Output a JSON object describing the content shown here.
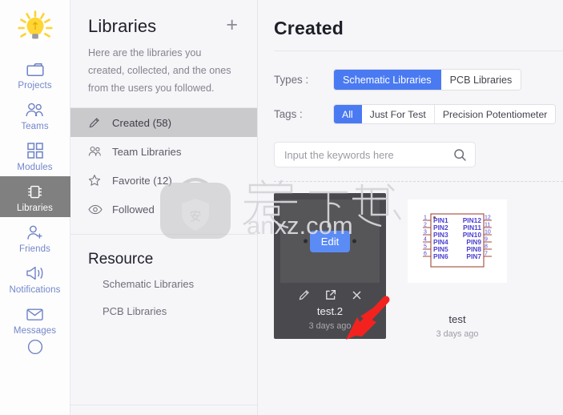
{
  "app": {
    "logo_icon": "lightbulb-icon",
    "accent_blue": "#4a7af2",
    "selected_gray": "#808080",
    "card_dark": "#4a4a4e"
  },
  "rail": {
    "items": [
      {
        "label": "Projects",
        "icon": "folder-icon",
        "active": false
      },
      {
        "label": "Teams",
        "icon": "users-icon",
        "active": false
      },
      {
        "label": "Modules",
        "icon": "grid-squares-icon",
        "active": false
      },
      {
        "label": "Libraries",
        "icon": "chip-icon",
        "active": true
      },
      {
        "label": "Friends",
        "icon": "user-plus-icon",
        "active": false
      },
      {
        "label": "Notifications",
        "icon": "megaphone-icon",
        "active": false
      },
      {
        "label": "Messages",
        "icon": "envelope-icon",
        "active": false
      }
    ]
  },
  "panel": {
    "title": "Libraries",
    "add_icon": "plus-icon",
    "description": "Here are the libraries you created, collected, and the ones from the users you followed.",
    "nav": [
      {
        "label": "Created (58)",
        "icon": "pencil-icon",
        "active": true
      },
      {
        "label": "Team Libraries",
        "icon": "users-icon",
        "active": false
      },
      {
        "label": "Favorite (12)",
        "icon": "star-icon",
        "active": false
      },
      {
        "label": "Followed",
        "icon": "eye-icon",
        "active": false
      }
    ],
    "resource_title": "Resource",
    "resource_items": [
      {
        "label": "Schematic Libraries"
      },
      {
        "label": "PCB Libraries"
      }
    ]
  },
  "main": {
    "title": "Created",
    "types": {
      "label": "Types :",
      "options": [
        "Schematic Libraries",
        "PCB Libraries"
      ],
      "selected": "Schematic Libraries"
    },
    "tags": {
      "label": "Tags :",
      "options": [
        "All",
        "Just For Test",
        "Precision Potentiometer"
      ],
      "selected": "All"
    },
    "search": {
      "placeholder": "Input the keywords here",
      "value": "",
      "icon": "search-icon"
    },
    "cards": [
      {
        "name": "test.2",
        "date": "3 days ago",
        "selected": true,
        "thumb_kind": "edit-chip",
        "thumb_label": "Edit",
        "actions": [
          {
            "icon": "pencil-icon",
            "name": "edit-action"
          },
          {
            "icon": "external-link-icon",
            "name": "open-action"
          },
          {
            "icon": "close-x-icon",
            "name": "delete-action"
          }
        ]
      },
      {
        "name": "test",
        "date": "3 days ago",
        "selected": false,
        "thumb_kind": "schematic-symbol",
        "symbol": {
          "left_pins": [
            {
              "num": "1",
              "label": "PIN1"
            },
            {
              "num": "2",
              "label": "PIN2"
            },
            {
              "num": "3",
              "label": "PIN3"
            },
            {
              "num": "4",
              "label": "PIN4"
            },
            {
              "num": "5",
              "label": "PIN5"
            },
            {
              "num": "6",
              "label": "PIN6"
            }
          ],
          "right_pins": [
            {
              "num": "12",
              "label": "PIN12"
            },
            {
              "num": "11",
              "label": "PIN11"
            },
            {
              "num": "10",
              "label": "PIN10"
            },
            {
              "num": "9",
              "label": "PIN9"
            },
            {
              "num": "8",
              "label": "PIN8"
            },
            {
              "num": "7",
              "label": "PIN7"
            }
          ],
          "body_color": "#a04a3a",
          "pin_text_color": "#4b3fd0"
        }
      }
    ]
  },
  "watermark": {
    "cn_text": "安下载",
    "domain_text": "anxz.com",
    "bag_glyph": "安"
  },
  "annotation": {
    "arrow_color": "#f4221f",
    "points_to": "open-action"
  }
}
